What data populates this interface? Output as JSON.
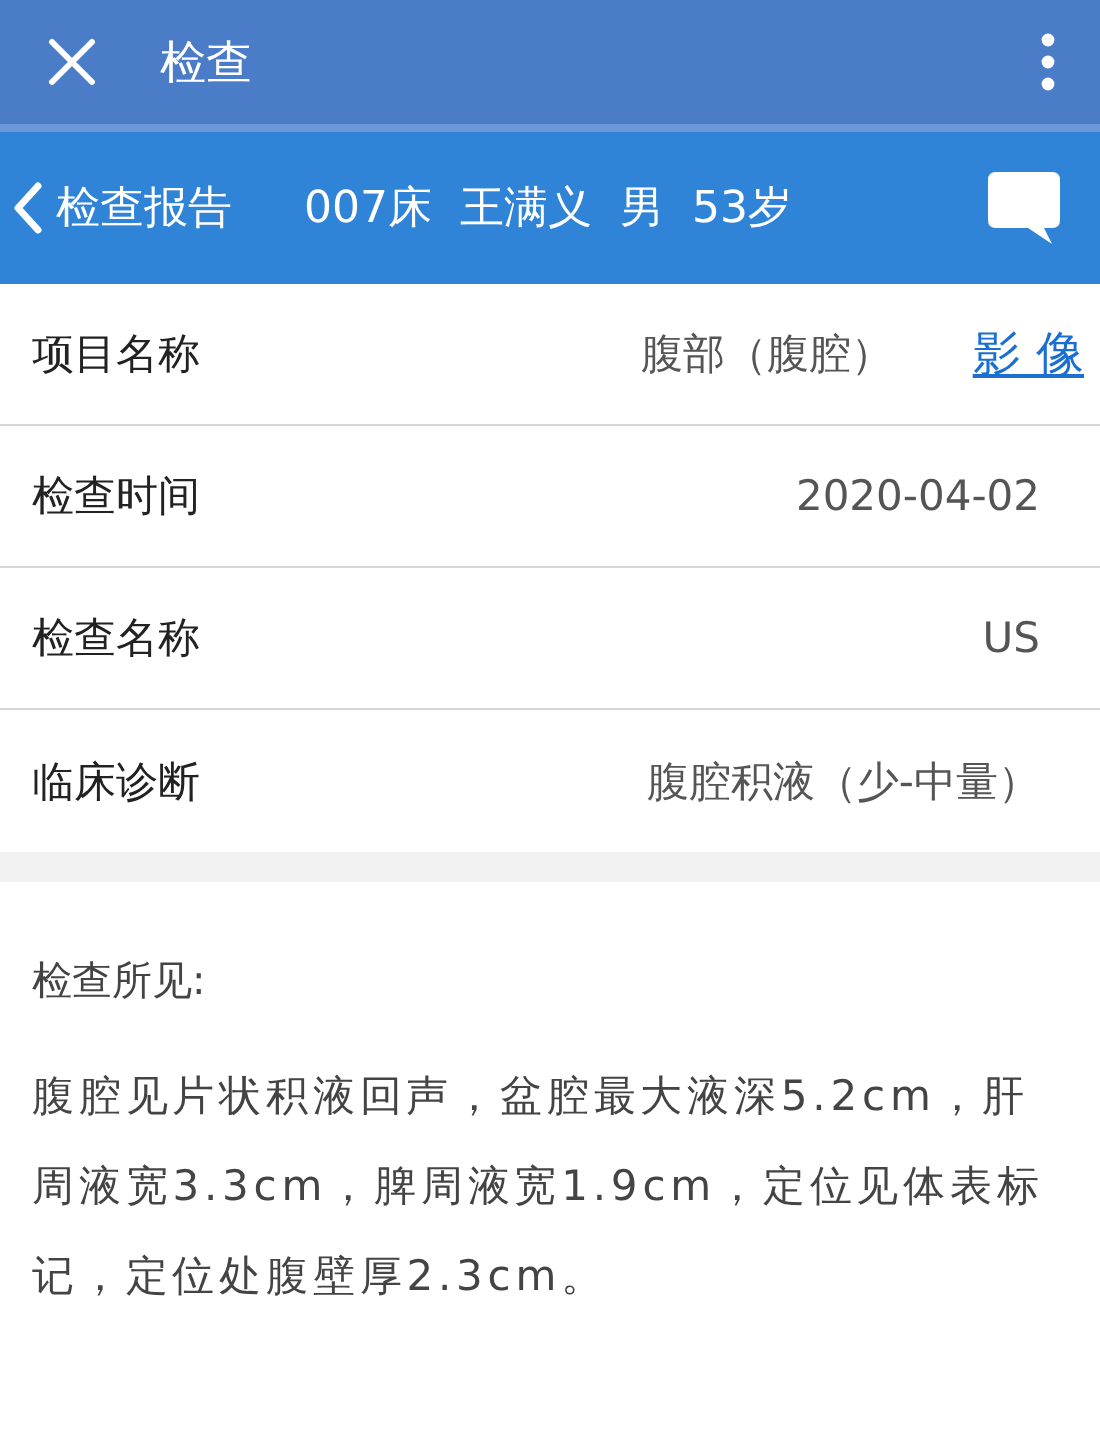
{
  "top_bar": {
    "title": "检查"
  },
  "sub_bar": {
    "back_label": "检查报告",
    "patient": [
      "007床",
      "王满义",
      "男",
      "53岁"
    ]
  },
  "rows": [
    {
      "label": "项目名称",
      "value": "腹部（腹腔）",
      "link": "影 像"
    },
    {
      "label": "检查时间",
      "value": "2020-04-02"
    },
    {
      "label": "检查名称",
      "value": "US"
    },
    {
      "label": "临床诊断",
      "value": "腹腔积液（少-中量）"
    }
  ],
  "findings": {
    "heading": "检查所见:",
    "text": "腹腔见片状积液回声，盆腔最大液深5.2cm，肝周液宽3.3cm，脾周液宽1.9cm，定位见体表标记，定位处腹壁厚2.3cm。"
  }
}
